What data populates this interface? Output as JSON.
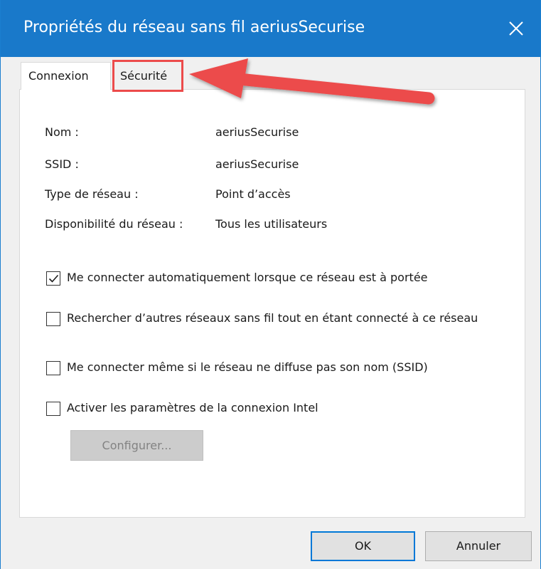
{
  "window": {
    "title": "Propriétés du réseau sans fil aeriusSecurise",
    "titlebar_color": "#1979ca"
  },
  "tabs": [
    {
      "label": "Connexion",
      "active": true
    },
    {
      "label": "Sécurité",
      "active": false,
      "highlight_color": "#ec4b4b"
    }
  ],
  "info": [
    {
      "label": "Nom :",
      "value": "aeriusSecurise"
    },
    {
      "label": "SSID :",
      "value": "aeriusSecurise"
    },
    {
      "label": "Type de réseau :",
      "value": "Point d’accès"
    },
    {
      "label": "Disponibilité du réseau :",
      "value": "Tous les utilisateurs"
    }
  ],
  "options": [
    {
      "label": "Me connecter automatiquement lorsque ce réseau est à portée",
      "checked": true
    },
    {
      "label": "Rechercher d’autres réseaux sans fil tout en étant connecté à ce réseau",
      "checked": false
    },
    {
      "label": "Me connecter même si le réseau ne diffuse pas son nom (SSID)",
      "checked": false
    },
    {
      "label": "Activer les paramètres de la connexion Intel",
      "checked": false
    }
  ],
  "buttons": {
    "configure": "Configurer...",
    "ok": "OK",
    "cancel": "Annuler"
  },
  "annotation": {
    "icon": "arrow-left-icon",
    "color": "#ec4b4b"
  }
}
